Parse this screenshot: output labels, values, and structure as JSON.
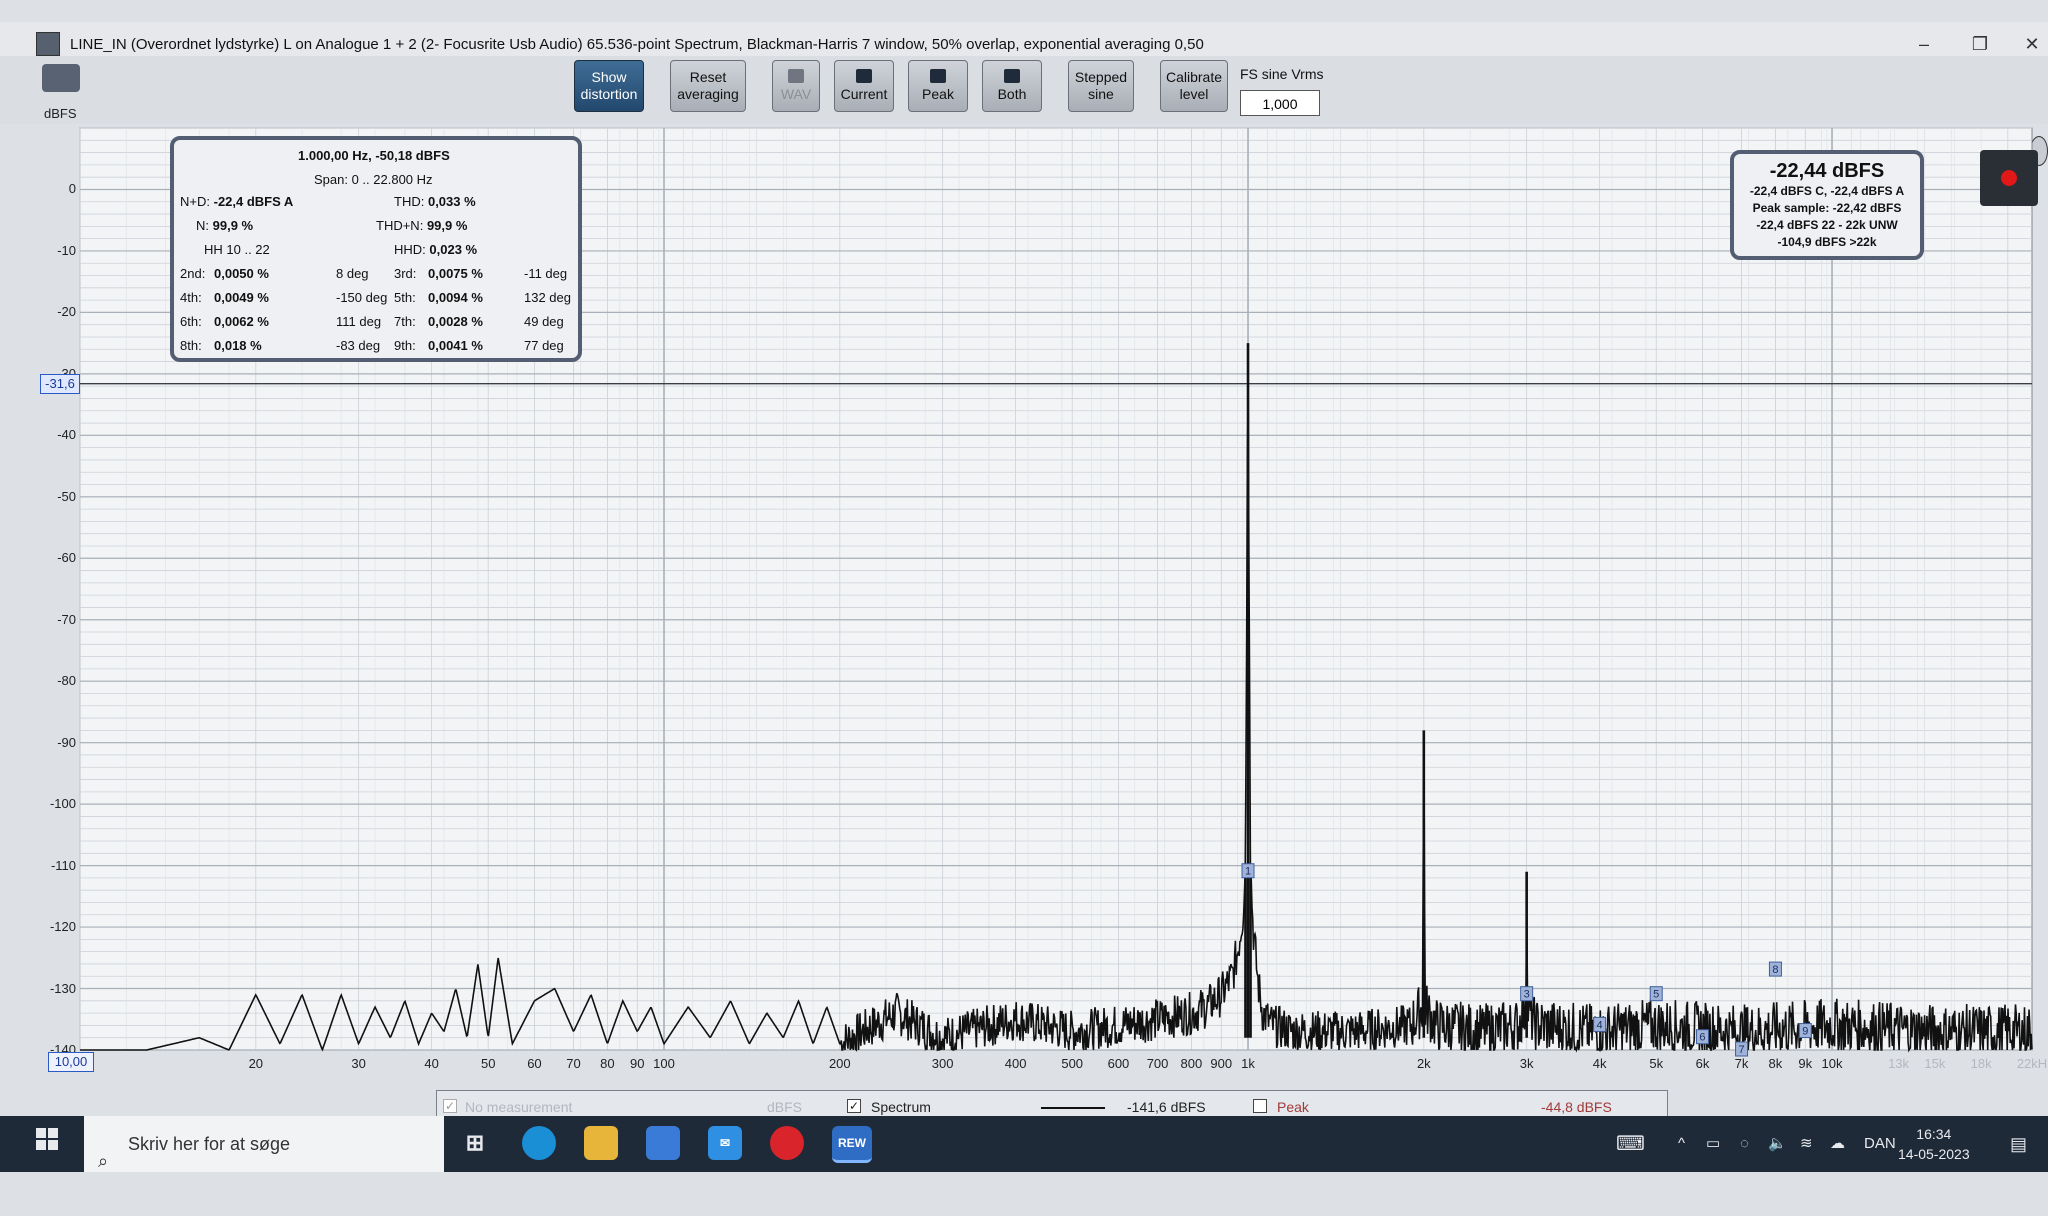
{
  "window": {
    "title": "LINE_IN (Overordnet lydstyrke) L on Analogue 1 + 2 (2- Focusrite Usb Audio) 65.536-point Spectrum, Blackman-Harris 7 window, 50% overlap, exponential averaging 0,50"
  },
  "toolbar": {
    "show_distortion": [
      "Show",
      "distortion"
    ],
    "reset_averaging": [
      "Reset",
      "averaging"
    ],
    "wav": "WAV",
    "current": "Current",
    "peak": "Peak",
    "both": "Both",
    "stepped_sine": [
      "Stepped",
      "sine"
    ],
    "calibrate_level": [
      "Calibrate",
      "level"
    ],
    "fs_label": "FS sine Vrms",
    "fs_value": "1,000"
  },
  "graph": {
    "y_unit": "dBFS",
    "cursor_value": "-31,6",
    "x_start": "10,00"
  },
  "distortion": {
    "header": "1.000,00 Hz, -50,18 dBFS",
    "span": "Span: 0 .. 22.800 Hz",
    "nd_label": "N+D:",
    "nd_value": "-22,4 dBFS A",
    "thd_label": "THD:",
    "thd_value": "0,033 %",
    "n_label": "N:",
    "n_value": "99,9 %",
    "thdn_label": "THD+N:",
    "thdn_value": "99,9 %",
    "hh_label": "HH 10 .. 22",
    "hhd_label": "HHD:",
    "hhd_value": "0,023 %",
    "rows": [
      {
        "l1": "2nd:",
        "v1": "0,0050 %",
        "d1": "8 deg",
        "l2": "3rd:",
        "v2": "0,0075 %",
        "d2": "-11 deg"
      },
      {
        "l1": "4th:",
        "v1": "0,0049 %",
        "d1": "-150 deg",
        "l2": "5th:",
        "v2": "0,0094 %",
        "d2": "132 deg"
      },
      {
        "l1": "6th:",
        "v1": "0,0062 %",
        "d1": "111 deg",
        "l2": "7th:",
        "v2": "0,0028 %",
        "d2": "49 deg"
      },
      {
        "l1": "8th:",
        "v1": "0,018 %",
        "d1": "-83 deg",
        "l2": "9th:",
        "v2": "0,0041 %",
        "d2": "77 deg"
      }
    ]
  },
  "level": {
    "main": "-22,44 dBFS",
    "l1": "-22,4 dBFS C, -22,4 dBFS A",
    "l2": "Peak sample: -22,42 dBFS",
    "l3": "-22,4 dBFS 22 - 22k UNW",
    "l4": "-104,9 dBFS >22k"
  },
  "legend": {
    "no_measurement": "No measurement",
    "no_measurement_unit": "dBFS",
    "spectrum": "Spectrum",
    "spectrum_value": "-141,6 dBFS",
    "peak": "Peak",
    "peak_value": "-44,8 dBFS"
  },
  "taskbar": {
    "search_placeholder": "Skriv her for at søge",
    "rew_label": "REW",
    "language": "DAN",
    "time": "16:34",
    "date": "14-05-2023"
  },
  "colors": {
    "trace": "#111111",
    "grid_major": "#a9b0b8",
    "grid_minor": "#cdd2d8",
    "plot_bg": "#f2f4f6",
    "accent": "#2b5d8a"
  },
  "chart_data": {
    "type": "line",
    "ylabel": "dBFS",
    "yscale": "linear",
    "ylim": [
      -140,
      10
    ],
    "yticks": [
      0,
      -10,
      -20,
      -30,
      -40,
      -50,
      -60,
      -70,
      -80,
      -90,
      -100,
      -110,
      -120,
      -130,
      -140
    ],
    "ytick_labels": [
      "0",
      "-10",
      "-20",
      "-30",
      "-40",
      "-50",
      "-60",
      "-70",
      "-80",
      "-90",
      "-100",
      "-110",
      "-120",
      "-130",
      "-140"
    ],
    "xscale": "log",
    "xlim": [
      10,
      22000
    ],
    "xticks": [
      20,
      30,
      40,
      50,
      60,
      70,
      80,
      90,
      100,
      200,
      300,
      400,
      500,
      600,
      700,
      800,
      900,
      1000,
      2000,
      3000,
      4000,
      5000,
      6000,
      7000,
      8000,
      9000,
      10000,
      13000,
      15000,
      18000,
      22000
    ],
    "xtick_labels": [
      "20",
      "30",
      "40",
      "50",
      "60",
      "70",
      "80",
      "90",
      "100",
      "200",
      "300",
      "400",
      "500",
      "600",
      "700",
      "800",
      "900",
      "1k",
      "2k",
      "3k",
      "4k",
      "5k",
      "6k",
      "7k",
      "8k",
      "9k",
      "10k",
      "13k",
      "15k",
      "18k",
      "22kH"
    ],
    "x_faint_from": 13000,
    "cursor_y": -31.6,
    "series": [
      {
        "x": [
          10,
          13,
          16,
          18,
          20,
          22,
          24,
          26,
          28,
          30,
          32,
          34,
          36,
          38,
          40,
          42,
          44,
          46,
          48,
          50,
          52,
          55,
          60,
          65,
          70,
          75,
          80,
          85,
          90,
          95,
          100,
          110,
          120,
          130,
          140,
          150,
          160,
          170,
          180,
          190,
          200,
          250,
          300,
          400,
          500,
          600,
          700,
          800,
          850,
          900,
          940,
          960,
          980,
          990,
          1000,
          1010,
          1020,
          1040,
          1060,
          1100,
          1200,
          1500,
          1900,
          1990,
          2000,
          2010,
          2100,
          2500,
          2900,
          2990,
          3000,
          3010,
          3100,
          4000,
          5000,
          7000,
          10000,
          15000,
          22000
        ],
        "y": [
          -140,
          -140,
          -138,
          -140,
          -131,
          -139,
          -131,
          -140,
          -131,
          -139,
          -133,
          -138,
          -132,
          -139,
          -134,
          -137,
          -130,
          -138,
          -126,
          -138,
          -125,
          -139,
          -132,
          -130,
          -137,
          -131,
          -139,
          -132,
          -137,
          -133,
          -139,
          -133,
          -138,
          -132,
          -139,
          -134,
          -138,
          -132,
          -139,
          -133,
          -139,
          -134,
          -138,
          -135,
          -137,
          -136,
          -135,
          -134,
          -133,
          -131,
          -128,
          -124,
          -118,
          -110,
          -25,
          -110,
          -120,
          -129,
          -134,
          -136,
          -137,
          -137,
          -136,
          -133,
          -88,
          -133,
          -136,
          -137,
          -136,
          -133,
          -111,
          -133,
          -136,
          -137,
          -136,
          -137,
          -136,
          -137,
          -137
        ]
      }
    ],
    "markers": [
      {
        "label": "1",
        "x": 1000,
        "y": -111
      },
      {
        "label": "3",
        "x": 3000,
        "y": -131
      },
      {
        "label": "4",
        "x": 4000,
        "y": -136
      },
      {
        "label": "5",
        "x": 5000,
        "y": -131
      },
      {
        "label": "6",
        "x": 6000,
        "y": -138
      },
      {
        "label": "7",
        "x": 7000,
        "y": -140
      },
      {
        "label": "8",
        "x": 8000,
        "y": -127
      },
      {
        "label": "9",
        "x": 9000,
        "y": -137
      }
    ]
  }
}
